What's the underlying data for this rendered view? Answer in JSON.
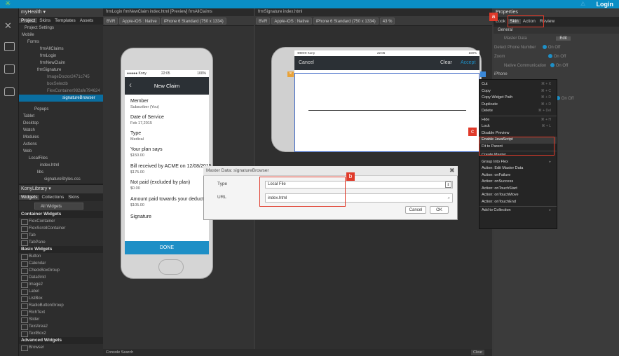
{
  "app": {
    "login_label": "Login"
  },
  "project": {
    "title": "myHealth ▾",
    "tabs": [
      "Project",
      "Skins",
      "Templates",
      "Assets"
    ],
    "tree": [
      "Project Settings",
      "Mobile",
      "Forms",
      "frmAllClaims",
      "frmLogin",
      "frmNewClaim",
      "frmSignature",
      "ImageDoctor2471c745",
      "boxSelectb",
      "FlexContainer982afe794624",
      "signatureBrowser",
      "Popups",
      "Tablet",
      "Desktop",
      "Watch",
      "Modules",
      "Actions",
      "Web",
      "LocalFiles",
      "index.html",
      "libs",
      "signatureStyles.css"
    ]
  },
  "library": {
    "title": "KonyLibrary ▾",
    "tabs": [
      "Widgets",
      "Collections",
      "Skins"
    ],
    "filter": "All Widgets",
    "container_title": "Container Widgets",
    "containers": [
      "FlexContainer",
      "FlexScrollContainer",
      "Tab",
      "TabPane"
    ],
    "basic_title": "Basic Widgets",
    "basic": [
      "Button",
      "Calendar",
      "CheckBoxGroup",
      "DataGrid",
      "Image2",
      "Label",
      "ListBox",
      "RadioButtonGroup",
      "RichText",
      "Slider",
      "TextArea2",
      "TextBox2"
    ],
    "advanced_title": "Advanced Widgets",
    "advanced": [
      "Browser"
    ]
  },
  "canvas1": {
    "tabs": "frmLogin   frmNewClaim   index.html [Preview]   frmAllClaims",
    "bvr": "BVR",
    "platform": "Apple-iOS : Native",
    "device": "iPhone 6 Standard (750 x 1334)",
    "phone": {
      "carrier": "●●●●● Kony",
      "time": "22:05",
      "battery": "100%",
      "title": "New Claim",
      "member_label": "Member",
      "member_value": "Subscriber (You)",
      "dos_label": "Date of Service",
      "dos_value": "Feb 17,2015",
      "type_label": "Type",
      "type_value": "Medical",
      "plan_label": "Your plan says",
      "plan_value": "$150.00",
      "bill_label": "Bill received by ACME on 12/08/2015",
      "bill_value": "$175.00",
      "notpaid_label": "Not paid (excluded by plan)",
      "notpaid_value": "$0.00",
      "amount_label": "Amount paid towards your deductible",
      "amount_value": "$105.00",
      "sig_label": "Signature",
      "done_label": "DONE"
    }
  },
  "canvas2": {
    "tabs": "frmSignature   index.html",
    "bvr": "BVR",
    "platform": "Apple-iOS : Native",
    "device": "iPhone 6 Standard (750 x 1334)",
    "zoom": "43",
    "zoom_unit": "%",
    "phone": {
      "carrier": "●●●●● Kony",
      "time": "22:05",
      "battery": "100%",
      "cancel": "Cancel",
      "clear": "Clear",
      "accept": "Accept"
    }
  },
  "properties": {
    "title": "Properties",
    "tabs": [
      "Look",
      "Skin",
      "Action",
      "Review"
    ],
    "general": "General",
    "rows": [
      {
        "label": "Master Data",
        "value": "Edit"
      },
      {
        "label": "Detect Phone Number",
        "value": "On  Off"
      },
      {
        "label": "Zoom",
        "value": "On  Off"
      },
      {
        "label": "Native Communication",
        "value": "On  Off"
      }
    ],
    "iphone": "iPhone",
    "extra": "On  Off"
  },
  "context_menu": [
    {
      "label": "Cut",
      "shortcut": "⌘ + X"
    },
    {
      "label": "Copy",
      "shortcut": "⌘ + C"
    },
    {
      "label": "Copy Widget Path",
      "shortcut": "⌘ + D"
    },
    {
      "label": "Duplicate",
      "shortcut": "⌘ + D"
    },
    {
      "label": "Delete",
      "shortcut": "⌘ + Del"
    },
    {
      "label": "Hide",
      "shortcut": "⌘ + H"
    },
    {
      "label": "Lock",
      "shortcut": "⌘ + L"
    },
    {
      "label": "Disable Preview",
      "shortcut": ""
    },
    {
      "label": "Enable JavaScript",
      "shortcut": ""
    },
    {
      "label": "Fit to Parent",
      "shortcut": ""
    },
    {
      "label": "Create Master",
      "shortcut": ""
    },
    {
      "label": "Group Into Flex",
      "shortcut": "▸"
    },
    {
      "label": "Action: Edit Master Data",
      "shortcut": ""
    },
    {
      "label": "Action: onFailure",
      "shortcut": ""
    },
    {
      "label": "Action: onSuccess",
      "shortcut": ""
    },
    {
      "label": "Action: onTouchStart",
      "shortcut": ""
    },
    {
      "label": "Action: onTouchMove",
      "shortcut": ""
    },
    {
      "label": "Action: onTouchEnd",
      "shortcut": ""
    },
    {
      "label": "Add to Collection",
      "shortcut": "▸"
    }
  ],
  "dialog": {
    "title": "Master Data: signatureBrowser",
    "type_label": "Type",
    "type_value": "Local File",
    "url_label": "URL",
    "url_value": "index.html",
    "cancel": "Cancel",
    "ok": "OK"
  },
  "console": {
    "tabs": "Console   Search",
    "clear": "Clear"
  },
  "callouts": {
    "a": "a",
    "b": "b",
    "c": "c"
  },
  "colors": {
    "accent": "#0a8ec5",
    "callout": "#e03a2a"
  }
}
